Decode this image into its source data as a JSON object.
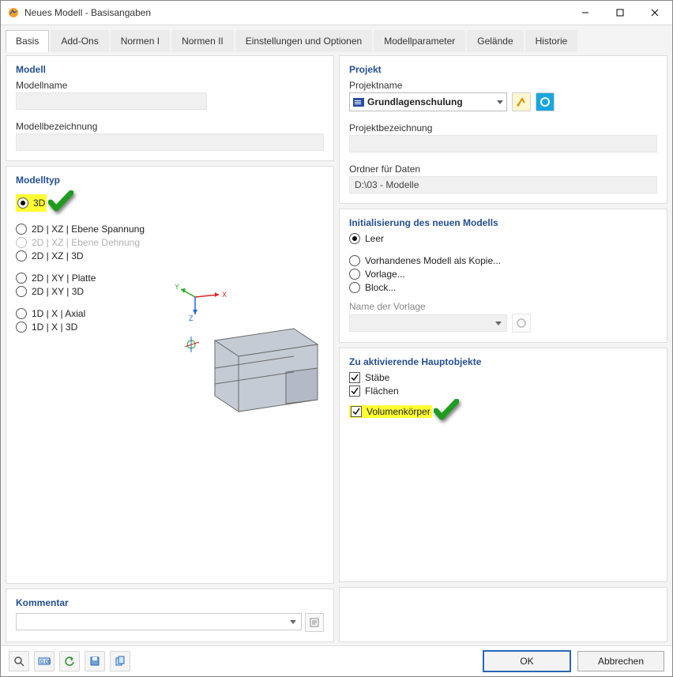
{
  "window": {
    "title": "Neues Modell - Basisangaben"
  },
  "tabs": {
    "items": [
      "Basis",
      "Add-Ons",
      "Normen I",
      "Normen II",
      "Einstellungen und Optionen",
      "Modellparameter",
      "Gelände",
      "Historie"
    ],
    "active_index": 0
  },
  "left": {
    "modell": {
      "title": "Modell",
      "modellname_label": "Modellname",
      "modellname_value": "",
      "modellbezeichnung_label": "Modellbezeichnung",
      "modellbezeichnung_value": ""
    },
    "modelltyp": {
      "title": "Modelltyp",
      "options": [
        {
          "label": "3D",
          "selected": true,
          "highlight": true
        },
        {
          "label": "2D | XZ | Ebene Spannung"
        },
        {
          "label": "2D | XZ | Ebene Dehnung",
          "disabled": true
        },
        {
          "label": "2D | XZ | 3D"
        },
        {
          "label": "2D | XY | Platte",
          "group_gap": true
        },
        {
          "label": "2D | XY | 3D"
        },
        {
          "label": "1D | X | Axial",
          "group_gap": true
        },
        {
          "label": "1D | X | 3D"
        }
      ]
    },
    "kommentar": {
      "title": "Kommentar",
      "value": ""
    }
  },
  "right": {
    "projekt": {
      "title": "Projekt",
      "projektname_label": "Projektname",
      "projektname_value": "Grundlagenschulung",
      "projektbezeichnung_label": "Projektbezeichnung",
      "projektbezeichnung_value": "",
      "folder_label": "Ordner für Daten",
      "folder_value": "D:\\03 - Modelle"
    },
    "init": {
      "title": "Initialisierung des neuen Modells",
      "options": [
        {
          "label": "Leer",
          "selected": true
        },
        {
          "label": "Vorhandenes Modell als Kopie...",
          "group_gap": true
        },
        {
          "label": "Vorlage..."
        },
        {
          "label": "Block..."
        }
      ],
      "template_label": "Name der Vorlage",
      "template_value": ""
    },
    "objects": {
      "title": "Zu aktivierende Hauptobjekte",
      "items": [
        {
          "label": "Stäbe",
          "checked": true
        },
        {
          "label": "Flächen",
          "checked": true
        },
        {
          "label": "Volumenkörper",
          "checked": true,
          "highlight": true
        }
      ]
    }
  },
  "footer": {
    "ok": "OK",
    "cancel": "Abbrechen"
  }
}
